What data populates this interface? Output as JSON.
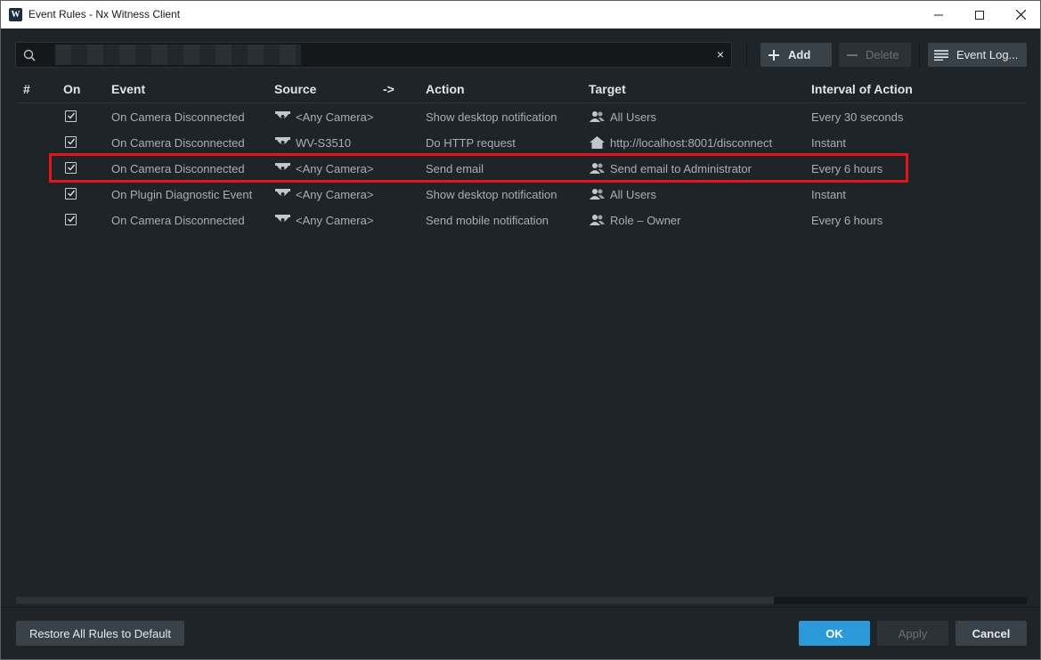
{
  "window": {
    "title": "Event Rules - Nx Witness Client",
    "app_icon_text": "W"
  },
  "search": {
    "value": "",
    "clear_glyph": "×"
  },
  "toolbar": {
    "add_label": "Add",
    "delete_label": "Delete",
    "event_log_label": "Event Log..."
  },
  "table": {
    "headers": {
      "index": "#",
      "on": "On",
      "event": "Event",
      "source": "Source",
      "arrow": "->",
      "action": "Action",
      "target": "Target",
      "interval": "Interval of Action"
    },
    "rows": [
      {
        "on": true,
        "event": "On Camera Disconnected",
        "source_icon": "camera-icon",
        "source": "<Any Camera>",
        "action": "Show desktop notification",
        "target_icon": "users-icon",
        "target": "All Users",
        "interval": "Every 30 seconds"
      },
      {
        "on": true,
        "event": "On Camera Disconnected",
        "source_icon": "camera-icon",
        "source": "WV-S3510",
        "action": "Do HTTP request",
        "target_icon": "home-icon",
        "target": "http://localhost:8001/disconnect",
        "interval": "Instant"
      },
      {
        "on": true,
        "event": "On Camera Disconnected",
        "source_icon": "camera-icon",
        "source": "<Any Camera>",
        "action": "Send email",
        "target_icon": "users-icon",
        "target": "Send email to Administrator",
        "interval": "Every 6 hours",
        "highlighted": true
      },
      {
        "on": true,
        "event": "On Plugin Diagnostic Event",
        "source_icon": "camera-icon",
        "source": "<Any Camera>",
        "action": "Show desktop notification",
        "target_icon": "users-icon",
        "target": "All Users",
        "interval": "Instant"
      },
      {
        "on": true,
        "event": "On Camera Disconnected",
        "source_icon": "camera-icon",
        "source": "<Any Camera>",
        "action": "Send mobile notification",
        "target_icon": "users-icon",
        "target": "Role – Owner",
        "interval": "Every 6 hours"
      }
    ]
  },
  "footer": {
    "restore_label": "Restore All Rules to Default",
    "ok_label": "OK",
    "apply_label": "Apply",
    "cancel_label": "Cancel"
  },
  "colors": {
    "background": "#1f2428",
    "accent": "#2c9ad8",
    "highlight_border": "#e3141b"
  }
}
